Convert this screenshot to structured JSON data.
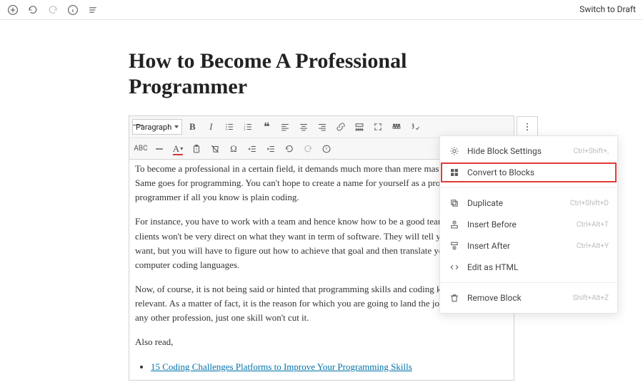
{
  "header": {
    "switch_to_draft": "Switch to Draft"
  },
  "post": {
    "title": "How to Become A Professional Programmer",
    "paragraph_1": "To become a professional in a certain field, it demands much more than mere mastery of that field. Same goes for programming. You can't hope to create a name for yourself as a professional programmer if all you know is plain coding.",
    "paragraph_2": "For instance, you have to work with a team and hence know how to be a good team player. Also, clients won't be very direct on what they want in term of software. They will tell you what goal they want, but you will have to figure out how to achieve that goal and then translate your solution in computer coding languages.",
    "paragraph_3": "Now, of course, it is not being said or hinted that programming skills and coding knowledge aren't relevant. As a matter of fact, it is the reason for which you are going to land the job. But much like any other profession, just one skill won't cut it.",
    "also_read": "Also read,",
    "link_1": "15 Coding Challenges Platforms to Improve Your Programming Skills"
  },
  "toolbar": {
    "format_select": "Paragraph"
  },
  "menu": {
    "hide_block_settings": {
      "label": "Hide Block Settings",
      "shortcut": "Ctrl+Shift+,"
    },
    "convert_to_blocks": {
      "label": "Convert to Blocks"
    },
    "duplicate": {
      "label": "Duplicate",
      "shortcut": "Ctrl+Shift+D"
    },
    "insert_before": {
      "label": "Insert Before",
      "shortcut": "Ctrl+Alt+T"
    },
    "insert_after": {
      "label": "Insert After",
      "shortcut": "Ctrl+Alt+Y"
    },
    "edit_as_html": {
      "label": "Edit as HTML"
    },
    "remove_block": {
      "label": "Remove Block",
      "shortcut": "Shift+Alt+Z"
    }
  }
}
